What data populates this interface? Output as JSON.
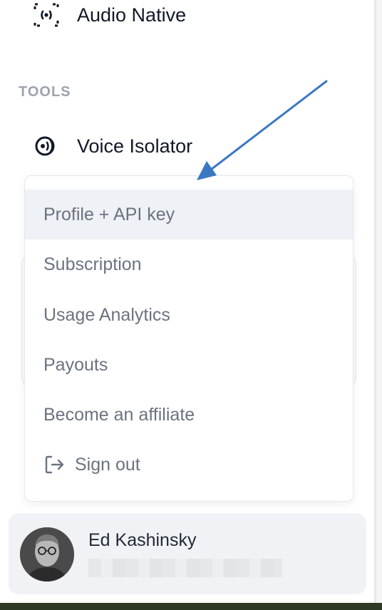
{
  "sidebar": {
    "audio_native_label": "Audio Native",
    "tools_section_label": "TOOLS",
    "voice_isolator_label": "Voice Isolator"
  },
  "menu": {
    "items": [
      {
        "label": "Profile + API key"
      },
      {
        "label": "Subscription"
      },
      {
        "label": "Usage Analytics"
      },
      {
        "label": "Payouts"
      },
      {
        "label": "Become an affiliate"
      },
      {
        "label": "Sign out"
      }
    ]
  },
  "user": {
    "name": "Ed Kashinsky"
  },
  "colors": {
    "annotation_arrow": "#3b78c2",
    "active_item_bg": "#eef1f5"
  },
  "icons": {
    "audio_native": "audio-native-icon",
    "voice_isolator": "voice-isolator-icon",
    "sign_out": "sign-out-icon"
  }
}
